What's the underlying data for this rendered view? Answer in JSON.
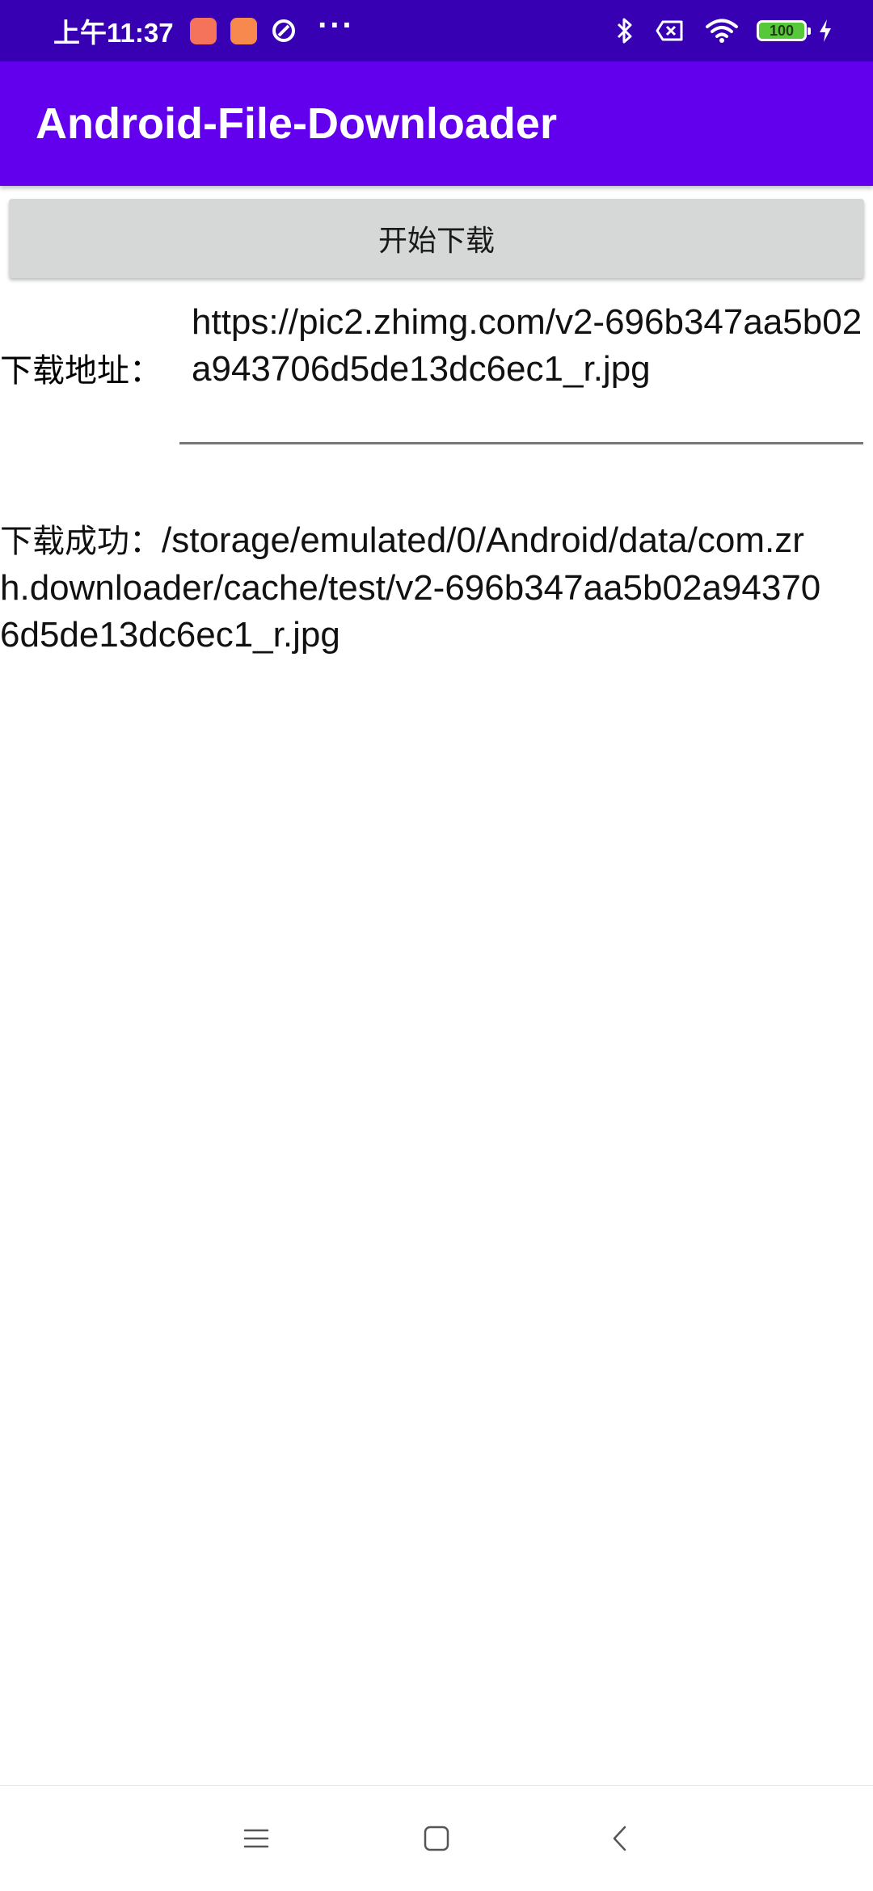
{
  "status_bar": {
    "time": "上午11:37",
    "more": "···",
    "battery": "100",
    "icons": [
      "app-icon-red",
      "app-icon-orange",
      "ring-icon",
      "bluetooth-icon",
      "no-sim-icon",
      "wifi-icon",
      "battery-icon",
      "charging-icon"
    ]
  },
  "app_bar": {
    "title": "Android-File-Downloader",
    "color": "#6200EE",
    "status_color": "#3700B3"
  },
  "main": {
    "start_button_label": "开始下载",
    "url_label": "下载地址：",
    "url_value": "https://pic2.zhimg.com/v2-696b347aa5b02a943706d5de13dc6ec1_r.jpg",
    "result_label": "下载成功：",
    "result_path": "/storage/emulated/0/Android/data/com.zrh.downloader/cache/test/v2-696b347aa5b02a943706d5de13dc6ec1_r.jpg"
  },
  "nav_bar": {
    "icons": [
      "menu-icon",
      "home-icon",
      "back-icon"
    ]
  }
}
